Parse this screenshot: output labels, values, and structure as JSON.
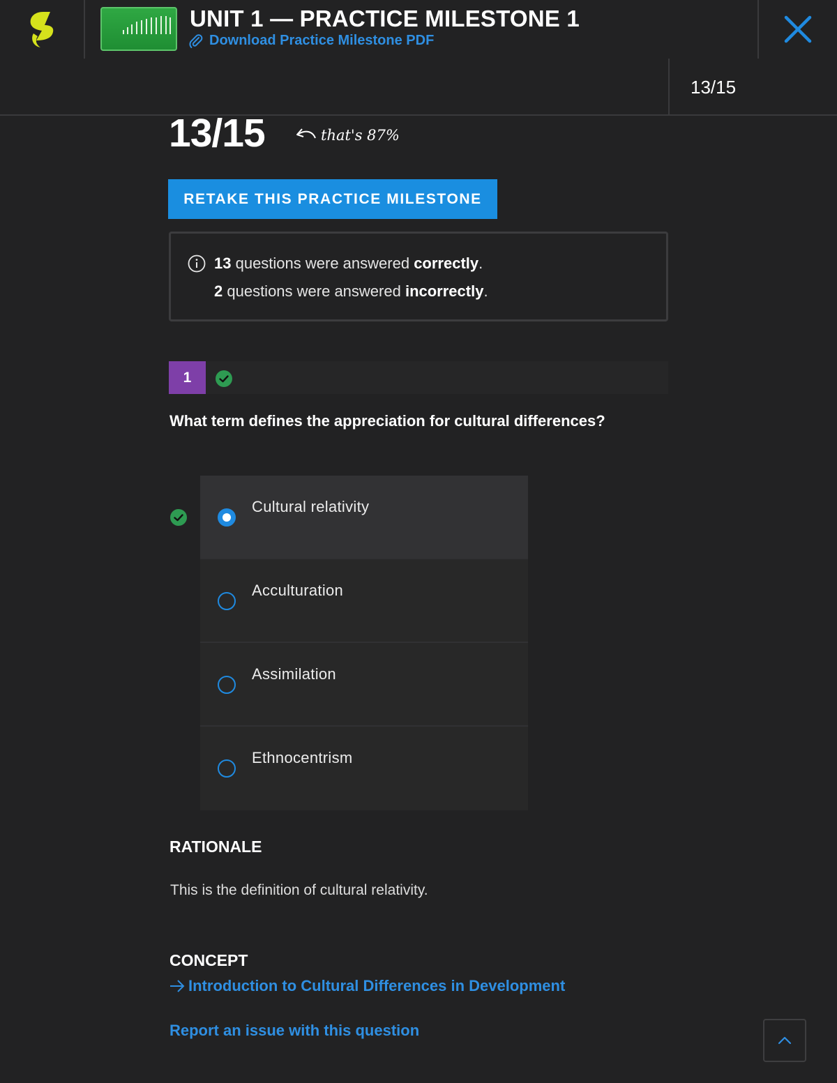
{
  "header": {
    "title": "UNIT 1 — PRACTICE MILESTONE 1",
    "pdf_link": "Download Practice Milestone PDF",
    "progress": "13/15",
    "colors": {
      "accent": "#1a8ee0",
      "logo": "#d6e21c",
      "thumbnail": "#2fa843"
    }
  },
  "score": {
    "value": "13/15",
    "note": "that's 87%",
    "retake_label": "RETAKE THIS PRACTICE MILESTONE"
  },
  "summary": {
    "correct_count": "13",
    "correct_text": " questions were answered ",
    "correct_word": "correctly",
    "incorrect_count": "2",
    "incorrect_text": " questions were answered ",
    "incorrect_word": "incorrectly",
    "period": "."
  },
  "question": {
    "number": "1",
    "status": "correct",
    "text": "What term defines the appreciation for cultural differences?",
    "options": [
      {
        "label": "Cultural relativity",
        "selected": true,
        "correct": true
      },
      {
        "label": "Acculturation",
        "selected": false,
        "correct": false
      },
      {
        "label": "Assimilation",
        "selected": false,
        "correct": false
      },
      {
        "label": "Ethnocentrism",
        "selected": false,
        "correct": false
      }
    ],
    "rationale_heading": "RATIONALE",
    "rationale_text": "This is the definition of cultural relativity.",
    "concept_heading": "CONCEPT",
    "concept_link": "Introduction to Cultural Differences in Development",
    "report_link": "Report an issue with this question"
  },
  "icons": {
    "logo": "sophia-logo-icon",
    "close": "close-icon",
    "paperclip": "paperclip-icon",
    "info": "info-icon",
    "check": "check-circle-icon",
    "arrow": "arrow-right-icon",
    "scroll_top": "chevron-up-icon"
  }
}
